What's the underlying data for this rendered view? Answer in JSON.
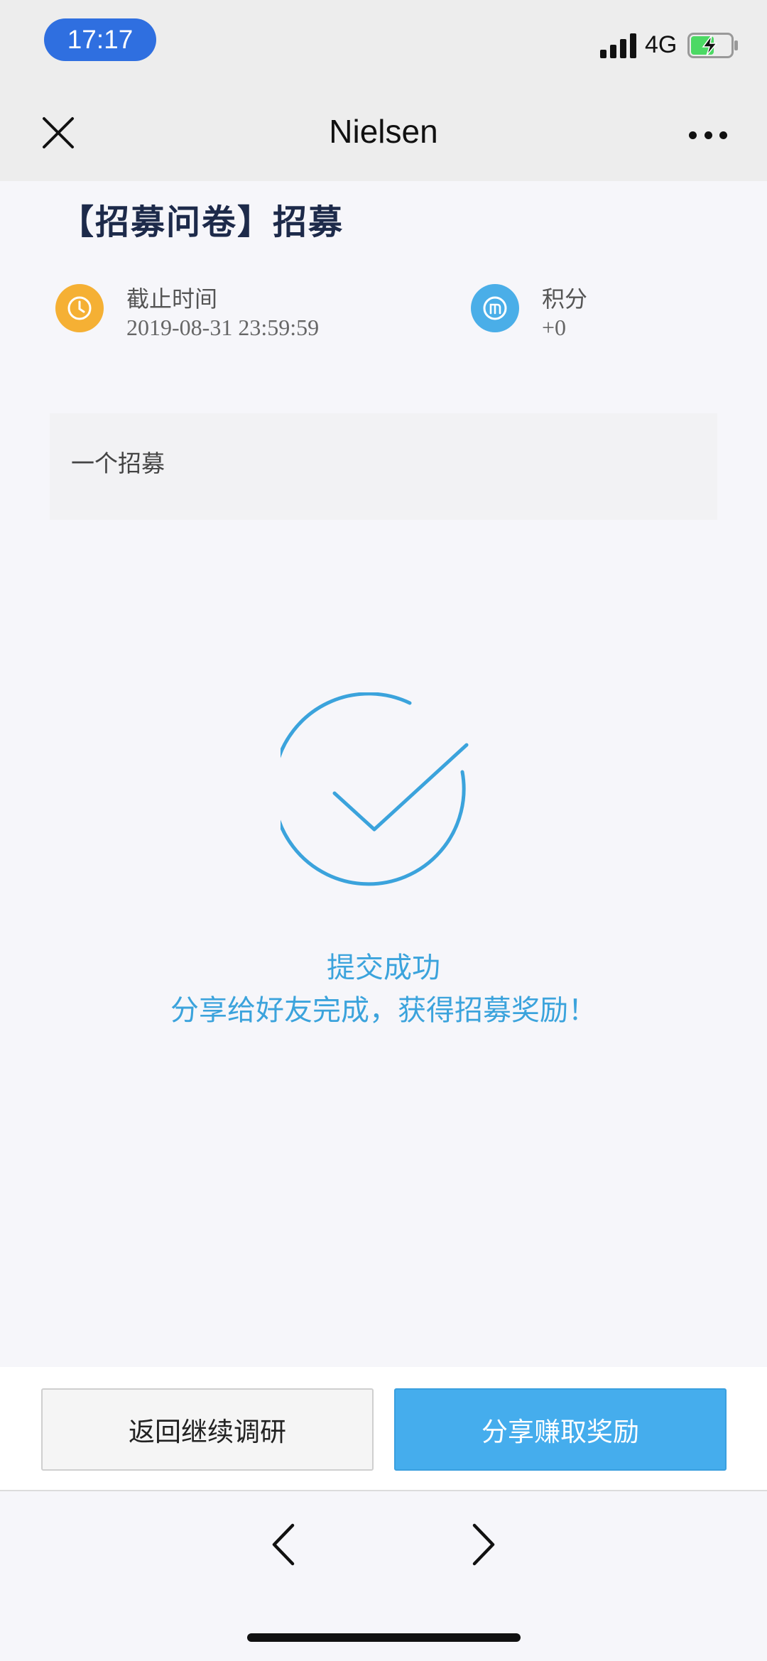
{
  "status_bar": {
    "time": "17:17",
    "network": "4G",
    "icons": [
      "signal-icon",
      "battery-charging-icon"
    ]
  },
  "nav_bar": {
    "title": "Nielsen",
    "icons": [
      "close-icon",
      "more-icon"
    ]
  },
  "survey": {
    "title": "【招募问卷】招募",
    "deadline": {
      "label": "截止时间",
      "value": "2019-08-31 23:59:59",
      "icon": "clock-icon",
      "icon_color": "#f5b034"
    },
    "points": {
      "label": "积分",
      "value": "+0",
      "icon": "points-icon",
      "icon_color": "#4aaee8"
    },
    "description": "一个招募"
  },
  "result": {
    "icon": "checkmark-icon",
    "accent_color": "#3ba3dc",
    "title": "提交成功",
    "subtitle": "分享给好友完成，获得招募奖励！"
  },
  "actions": {
    "back_label": "返回继续调研",
    "share_label": "分享赚取奖励",
    "share_color": "#45aded"
  },
  "bottom_nav": {
    "icons": [
      "chevron-left-icon",
      "chevron-right-icon"
    ]
  }
}
